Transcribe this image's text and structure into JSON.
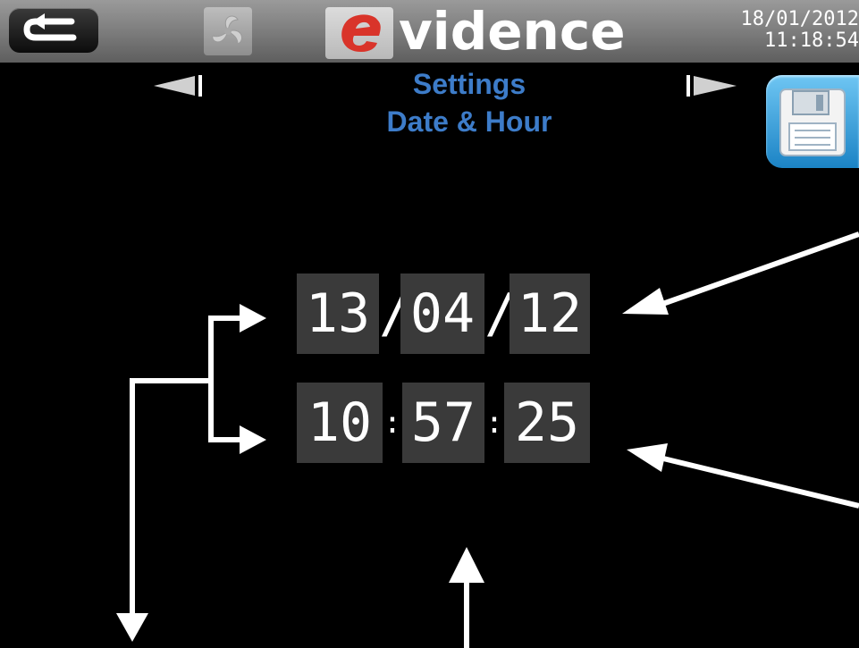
{
  "header": {
    "brand_text": "vidence",
    "brand_letter": "e",
    "datetime_line1": "18/01/2012",
    "datetime_line2": "11:18:54"
  },
  "page": {
    "title_line1": "Settings",
    "title_line2": "Date & Hour"
  },
  "date": {
    "day": "13",
    "month": "04",
    "year": "12",
    "separator": "/"
  },
  "time": {
    "hour": "10",
    "minute": "57",
    "second": "25",
    "separator": ":"
  },
  "icons": {
    "back": "back-arrow-icon",
    "app": "fan-icon",
    "prev": "triangle-left-icon",
    "next": "triangle-right-icon",
    "save": "floppy-disk-icon"
  },
  "colors": {
    "title": "#3d7cc9",
    "save_button": "#2a8fd0",
    "logo_red": "#d9342a"
  }
}
